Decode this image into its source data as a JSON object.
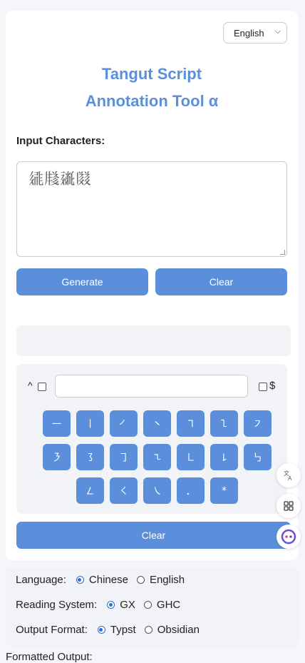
{
  "header": {
    "language_select": "English"
  },
  "title": {
    "line1": "Tangut Script",
    "line2": "Annotation Tool α"
  },
  "input": {
    "label": "Input Characters:",
    "value": "𗧓𗹦𗡶𗂸"
  },
  "buttons": {
    "generate": "Generate",
    "clear_top": "Clear",
    "clear_bottom": "Clear"
  },
  "stroke_search": {
    "caret": "^",
    "dollar": "$",
    "value": ""
  },
  "stroke_keys": [
    [
      "㇐",
      "㇑",
      "㇒",
      "㇔",
      "㇕",
      "㇅",
      "㇇"
    ],
    [
      "㇋",
      "㇌",
      "㇆",
      "㇍",
      "㇗",
      "㇙",
      "㇉"
    ],
    [
      "㇜",
      "㇛",
      "㇏",
      "．",
      "*"
    ]
  ],
  "settings": {
    "language": {
      "label": "Language:",
      "options": [
        "Chinese",
        "English"
      ],
      "selected": "Chinese"
    },
    "reading_system": {
      "label": "Reading System:",
      "options": [
        "GX",
        "GHC"
      ],
      "selected": "GX"
    },
    "output_format": {
      "label": "Output Format:",
      "options": [
        "Typst",
        "Obsidian"
      ],
      "selected": "Typst"
    }
  },
  "output": {
    "label": "Formatted Output:"
  },
  "side_tools": [
    "translate-icon",
    "apps-grid-icon",
    "assistant-icon"
  ],
  "colors": {
    "accent": "#5b8fdc",
    "panel": "#f2f3f7"
  }
}
